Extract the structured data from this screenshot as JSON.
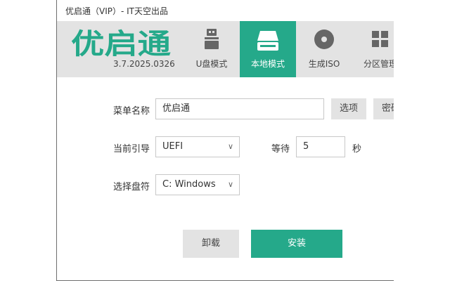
{
  "window": {
    "title": "优启通（VIP）- IT天空出品"
  },
  "header": {
    "logo_text": "优启通",
    "version": "3.7.2025.0326",
    "brand_color": "#25a98a",
    "tabs": [
      {
        "label": "U盘模式",
        "icon": "usb-drive-icon",
        "active": false
      },
      {
        "label": "本地模式",
        "icon": "hard-drive-icon",
        "active": true
      },
      {
        "label": "生成ISO",
        "icon": "disc-icon",
        "active": false
      },
      {
        "label": "分区管理",
        "icon": "partition-grid-icon",
        "active": false
      }
    ]
  },
  "form": {
    "menu_name_label": "菜单名称",
    "menu_name_value": "优启通",
    "options_button": "选项",
    "password_button": "密码",
    "boot_label": "当前引导",
    "boot_value": "UEFI",
    "wait_label": "等待",
    "wait_value": "5",
    "wait_unit": "秒",
    "drive_label": "选择盘符",
    "drive_value": "C: Windows"
  },
  "actions": {
    "uninstall_label": "卸载",
    "install_label": "安装"
  }
}
